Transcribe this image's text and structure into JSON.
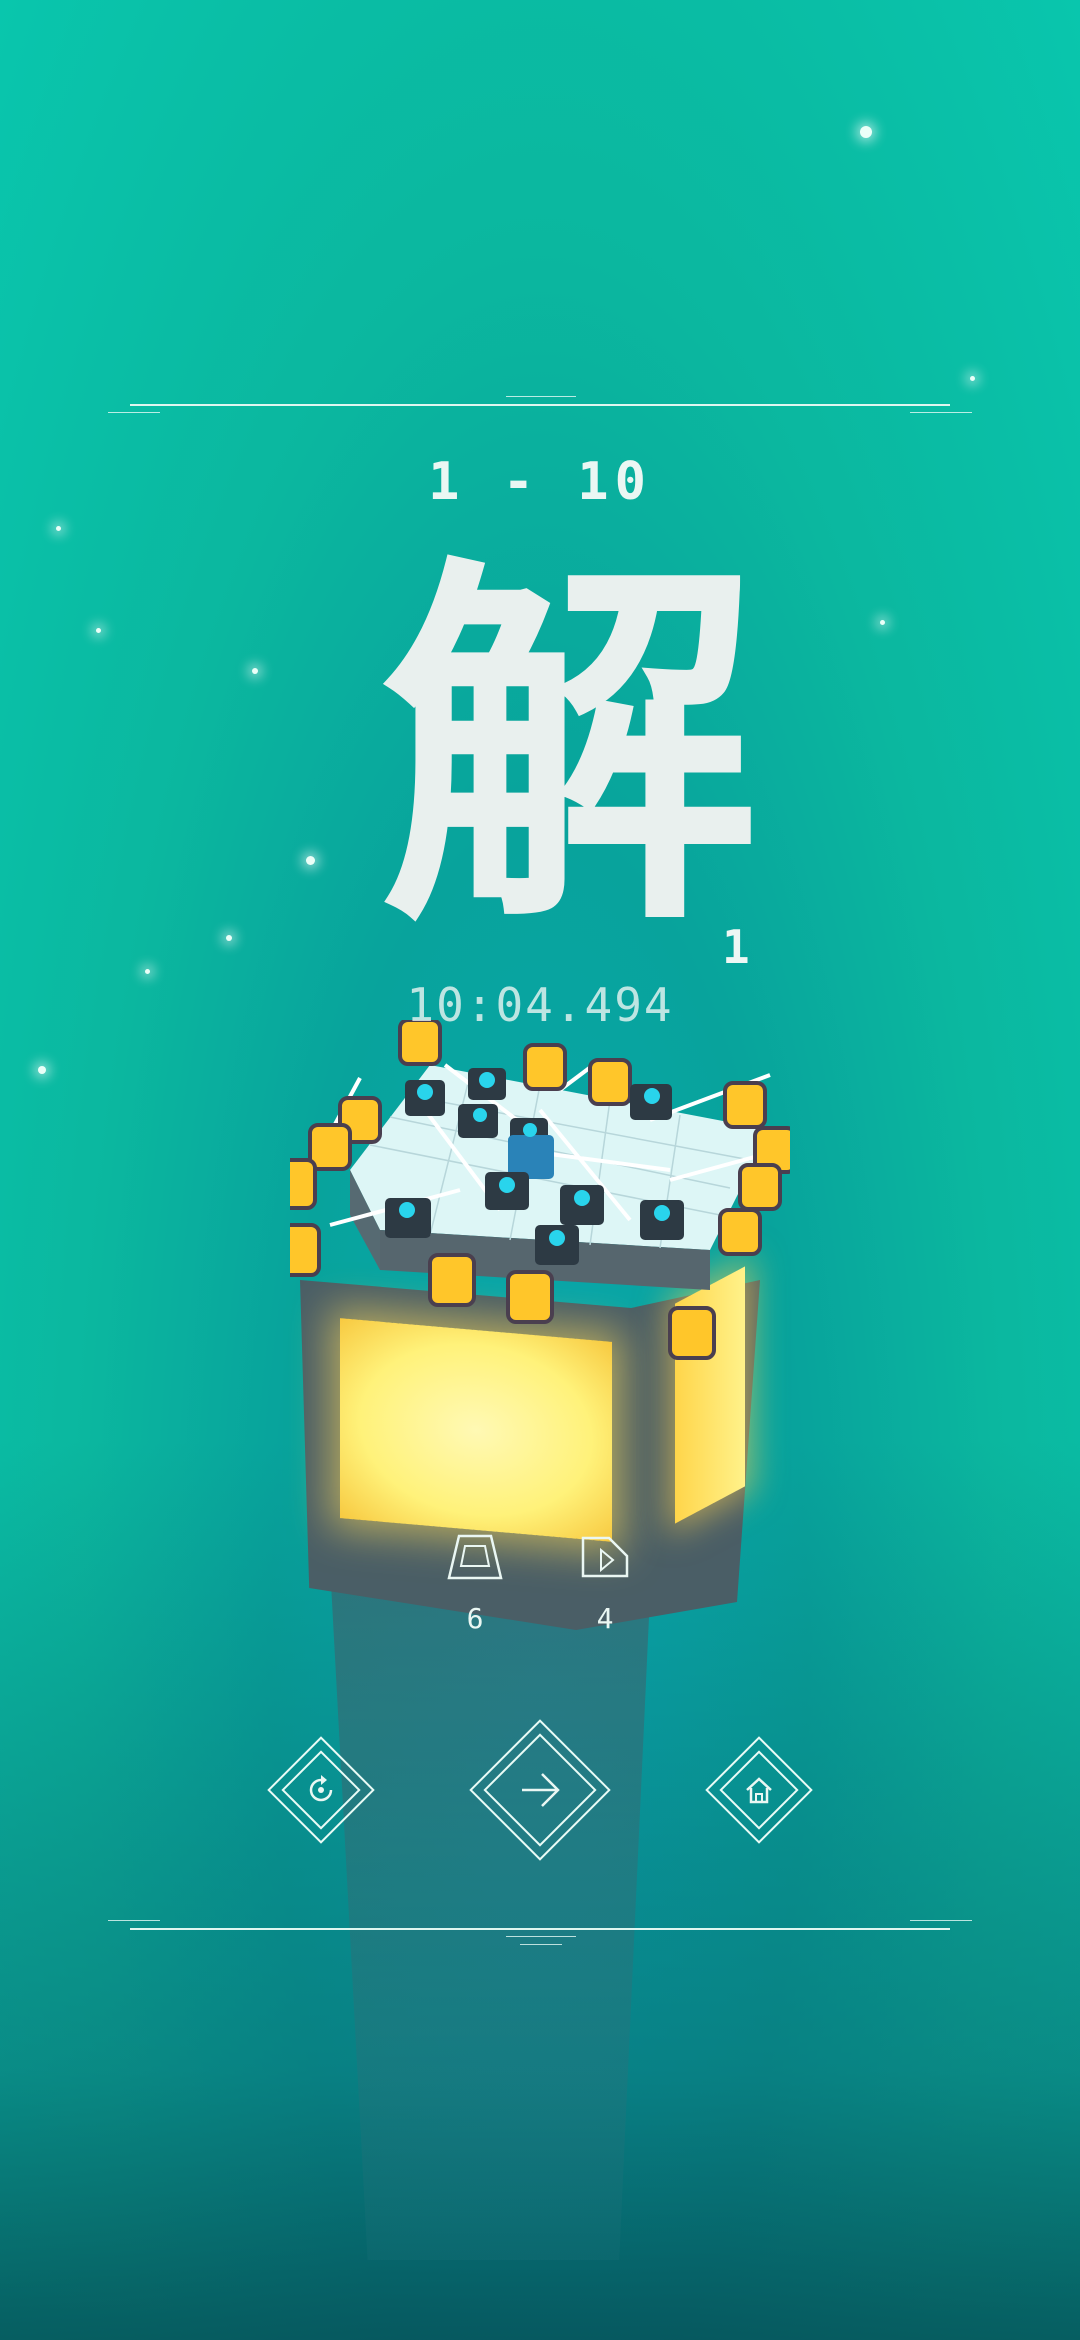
{
  "level": {
    "label": "1 - 10"
  },
  "result": {
    "glyph": "解",
    "count": "1",
    "time": "10:04.494"
  },
  "shape_counters": [
    {
      "icon": "trapezoid-icon",
      "value": "6"
    },
    {
      "icon": "cut-square-icon",
      "value": "4"
    }
  ],
  "buttons": {
    "retry": "retry-icon",
    "next": "arrow-right-icon",
    "home": "home-icon"
  },
  "colors": {
    "accent_line": "#dff6f0",
    "lamp": "#ffd54a",
    "node": "#29d4ec"
  }
}
